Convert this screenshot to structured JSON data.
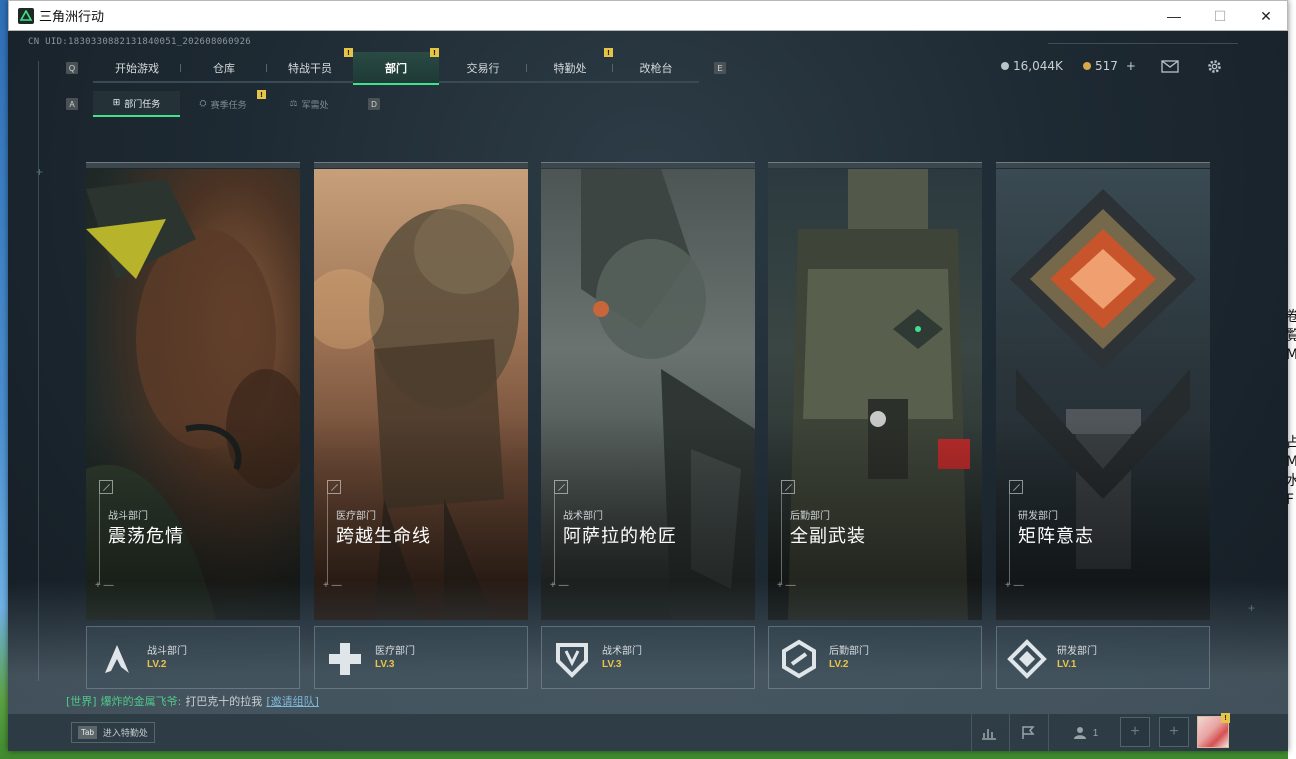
{
  "window": {
    "title": "三角洲行动",
    "minimize": "—",
    "maximize": "☐",
    "close": "✕"
  },
  "uid": "CN UID:1830330882131840051_202608060926",
  "keys": {
    "prev_tab": "Q",
    "next_tab": "E",
    "prev_sub": "A",
    "next_sub": "D",
    "tab_key": "Tab"
  },
  "nav": {
    "tabs": [
      {
        "label": "开始游戏",
        "badge": ""
      },
      {
        "label": "仓库",
        "badge": ""
      },
      {
        "label": "特战干员",
        "badge": "!"
      },
      {
        "label": "部门",
        "badge": "!",
        "active": true
      },
      {
        "label": "交易行",
        "badge": ""
      },
      {
        "label": "特勤处",
        "badge": "!"
      },
      {
        "label": "改枪台",
        "badge": ""
      }
    ]
  },
  "subnav": {
    "tabs": [
      {
        "label": "部门任务",
        "active": true,
        "badge": ""
      },
      {
        "label": "赛季任务",
        "badge": "!"
      },
      {
        "label": "军需处",
        "badge": ""
      }
    ]
  },
  "header": {
    "currency1": "16,044K",
    "currency2": "517",
    "add": "+"
  },
  "cards": [
    {
      "dept": "战斗部门",
      "title": "震荡危情",
      "level_name": "战斗部门",
      "level": "LV.2"
    },
    {
      "dept": "医疗部门",
      "title": "跨越生命线",
      "level_name": "医疗部门",
      "level": "LV.3"
    },
    {
      "dept": "战术部门",
      "title": "阿萨拉的枪匠",
      "level_name": "战术部门",
      "level": "LV.3"
    },
    {
      "dept": "后勤部门",
      "title": "全副武装",
      "level_name": "后勤部门",
      "level": "LV.2"
    },
    {
      "dept": "研发部门",
      "title": "矩阵意志",
      "level_name": "研发部门",
      "level": "LV.1"
    }
  ],
  "chat": {
    "channel": "[世界]",
    "sender": "爆炸的金属飞爷:",
    "message": "打巴克十的拉我",
    "link": "[邀请组队]"
  },
  "bottom": {
    "tab_label": "进入特勤处",
    "squad_count": "1",
    "slot_plus": "+"
  },
  "colors": {
    "accent": "#43e08f",
    "badge": "#e6c44a",
    "level": "#e8c54a"
  }
}
